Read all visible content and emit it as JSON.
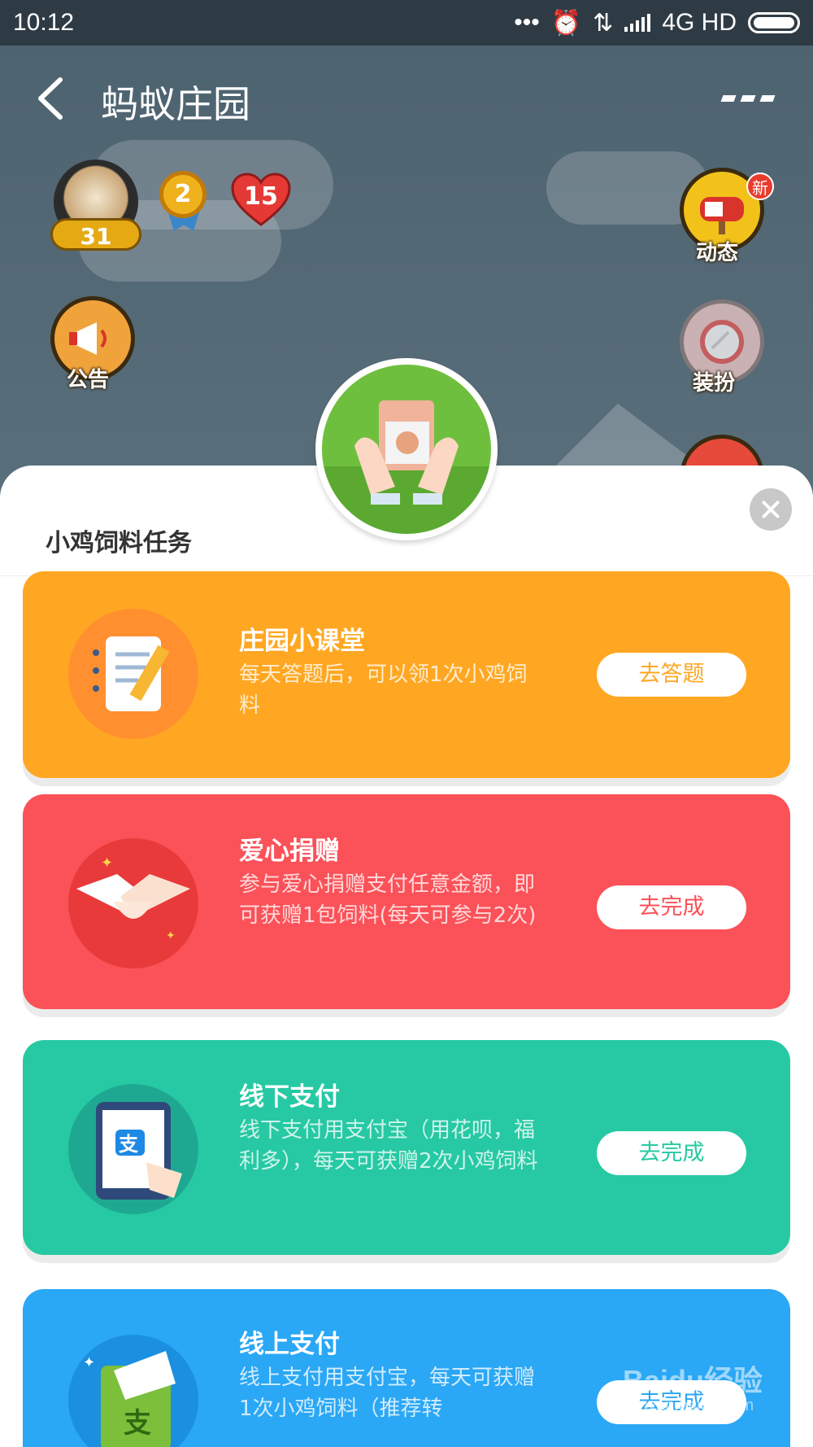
{
  "status_bar": {
    "time": "10:12",
    "dots": "•••",
    "network": "4G HD"
  },
  "header": {
    "title": "蚂蚁庄园"
  },
  "profile": {
    "level": "31",
    "medal_count": "2",
    "love_count": "15"
  },
  "side_buttons": [
    {
      "label": "动态",
      "badge": "新"
    },
    {
      "label": "公告"
    },
    {
      "label": "装扮"
    }
  ],
  "sheet": {
    "title": "小鸡饲料任务"
  },
  "tasks": [
    {
      "title": "庄园小课堂",
      "desc": "每天答题后，可以领1次小鸡饲料",
      "button": "去答题",
      "color": "#ffa722",
      "btn_color": "#ffa722"
    },
    {
      "title": "爱心捐赠",
      "desc": "参与爱心捐赠支付任意金额，即可获赠1包饲料(每天可参与2次)",
      "button": "去完成",
      "color": "#fb5158",
      "btn_color": "#fb5158"
    },
    {
      "title": "线下支付",
      "desc": "线下支付用支付宝（用花呗，福利多），每天可获赠2次小鸡饲料",
      "button": "去完成",
      "color": "#26c9a3",
      "btn_color": "#26c9a3"
    },
    {
      "title": "线上支付",
      "desc": "线上支付用支付宝，每天可获赠1次小鸡饲料（推荐转",
      "button": "去完成",
      "color": "#2aa7f5",
      "btn_color": "#2aa7f5"
    }
  ],
  "watermark": {
    "brand": "Baidu经验",
    "url": "jingyan.baidu.com"
  }
}
